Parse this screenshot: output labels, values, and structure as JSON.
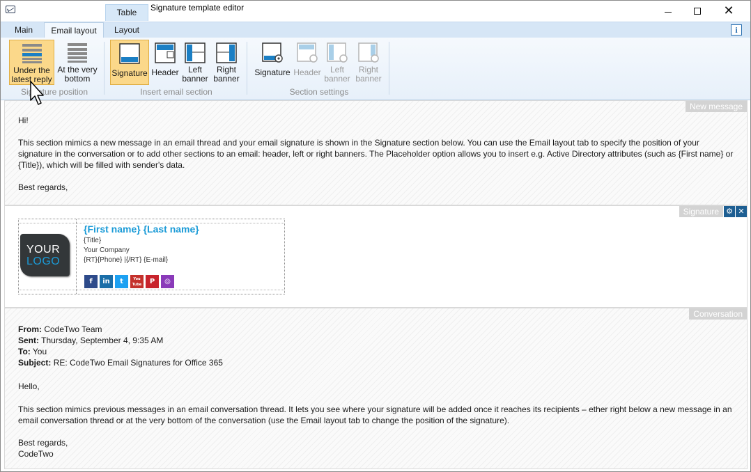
{
  "window": {
    "title": "Signature template editor",
    "context_tab": "Table"
  },
  "tabs": [
    {
      "label": "Main"
    },
    {
      "label": "Email layout"
    },
    {
      "label": "Layout"
    }
  ],
  "ribbon": {
    "position": {
      "group_label": "Signature position",
      "under_latest_reply": "Under the latest reply",
      "very_bottom": "At the very bottom"
    },
    "insert": {
      "group_label": "Insert email section",
      "signature": "Signature",
      "header": "Header",
      "left_banner": "Left banner",
      "right_banner": "Right banner"
    },
    "settings": {
      "group_label": "Section settings",
      "signature": "Signature",
      "header": "Header",
      "left_banner": "Left banner",
      "right_banner": "Right banner"
    }
  },
  "new_message": {
    "tag": "New message",
    "greeting": "Hi!",
    "body": "This section mimics a new message in an email thread and your email signature is shown in the Signature section below. You can use the Email layout tab to specify the position of your signature in the conversation or to add other sections to an email: header, left or right banners. The Placeholder option allows you to insert e.g. Active Directory attributes (such as {First name} or {Title}), which will be filled with sender's data.",
    "closing": "Best regards,"
  },
  "signature": {
    "tag": "Signature",
    "logo_line1": "YOUR",
    "logo_line2": "LOGO",
    "name": "{First name} {Last name}",
    "title": "{Title}",
    "company": "Your Company",
    "contact": "{RT}{Phone} |{/RT} {E-mail}",
    "social": [
      {
        "icon": "facebook-icon",
        "glyph": "f",
        "color": "#2d4a8a"
      },
      {
        "icon": "linkedin-icon",
        "glyph": "in",
        "color": "#1a6ea8"
      },
      {
        "icon": "twitter-icon",
        "glyph": "t",
        "color": "#1da1f2"
      },
      {
        "icon": "youtube-icon",
        "glyph": "You Tube",
        "color": "#c4302b"
      },
      {
        "icon": "pinterest-icon",
        "glyph": "P",
        "color": "#c8232c"
      },
      {
        "icon": "instagram-icon",
        "glyph": "◎",
        "color": "#8a3ab9"
      }
    ]
  },
  "conversation": {
    "tag": "Conversation",
    "from_label": "From:",
    "from_value": "CodeTwo Team",
    "sent_label": "Sent:",
    "sent_value": "Thursday, September 4, 9:35 AM",
    "to_label": "To:",
    "to_value": "You",
    "subject_label": "Subject:",
    "subject_value": "RE: CodeTwo Email Signatures for Office 365",
    "greeting": "Hello,",
    "body": "This section mimics previous messages in an email conversation thread. It lets you see where your signature will be added once it reaches its recipients – ether right below a new message in an email conversation thread or at the very bottom of the conversation (use the Email layout tab to change the position of the signature).",
    "closing1": "Best regards,",
    "closing2": "CodeTwo"
  },
  "colors": {
    "accent": "#1b9bd7",
    "active_button": "#fbd88a",
    "ribbon": "#e7f0fa"
  }
}
